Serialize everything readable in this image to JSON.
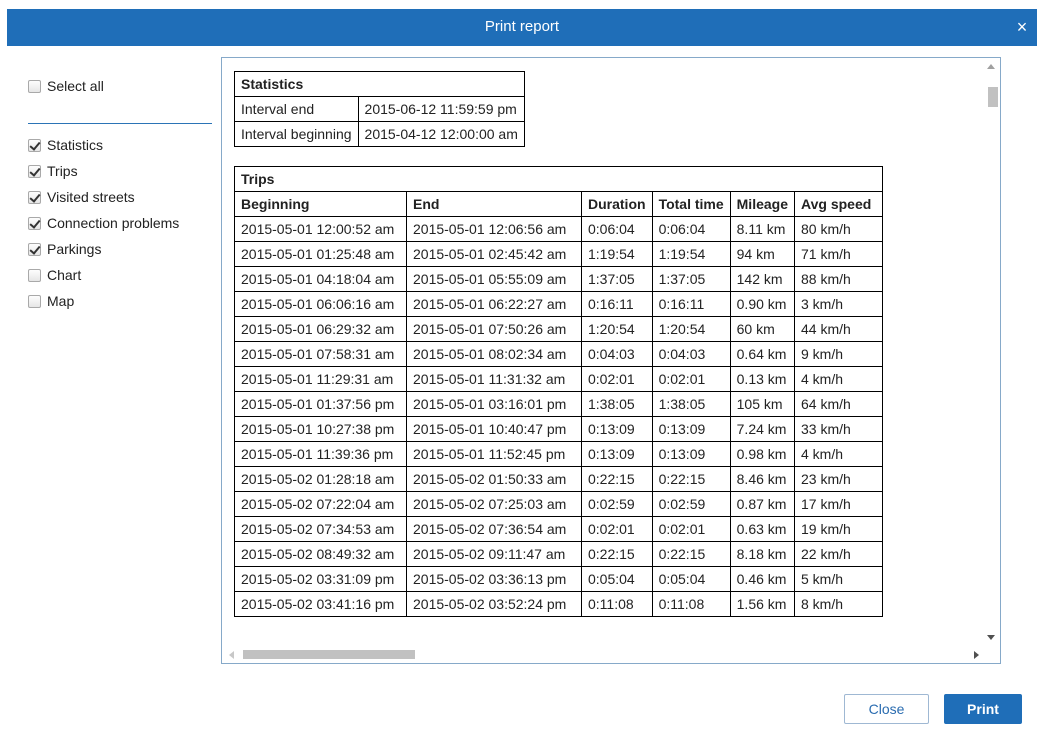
{
  "dialog": {
    "title": "Print report",
    "close_glyph": "×"
  },
  "sidebar": {
    "select_all": {
      "label": "Select all",
      "checked": false
    },
    "items": [
      {
        "label": "Statistics",
        "checked": true
      },
      {
        "label": "Trips",
        "checked": true
      },
      {
        "label": "Visited streets",
        "checked": true
      },
      {
        "label": "Connection problems",
        "checked": true
      },
      {
        "label": "Parkings",
        "checked": true
      },
      {
        "label": "Chart",
        "checked": false
      },
      {
        "label": "Map",
        "checked": false
      }
    ]
  },
  "statistics": {
    "title": "Statistics",
    "rows": [
      [
        "Interval end",
        "2015-06-12 11:59:59 pm"
      ],
      [
        "Interval beginning",
        "2015-04-12 12:00:00 am"
      ]
    ]
  },
  "trips": {
    "title": "Trips",
    "headers": [
      "Beginning",
      "End",
      "Duration",
      "Total time",
      "Mileage",
      "Avg speed"
    ],
    "rows": [
      [
        "2015-05-01 12:00:52 am",
        "2015-05-01 12:06:56 am",
        "0:06:04",
        "0:06:04",
        "8.11 km",
        "80 km/h"
      ],
      [
        "2015-05-01 01:25:48 am",
        "2015-05-01 02:45:42 am",
        "1:19:54",
        "1:19:54",
        "94 km",
        "71 km/h"
      ],
      [
        "2015-05-01 04:18:04 am",
        "2015-05-01 05:55:09 am",
        "1:37:05",
        "1:37:05",
        "142 km",
        "88 km/h"
      ],
      [
        "2015-05-01 06:06:16 am",
        "2015-05-01 06:22:27 am",
        "0:16:11",
        "0:16:11",
        "0.90 km",
        "3 km/h"
      ],
      [
        "2015-05-01 06:29:32 am",
        "2015-05-01 07:50:26 am",
        "1:20:54",
        "1:20:54",
        "60 km",
        "44 km/h"
      ],
      [
        "2015-05-01 07:58:31 am",
        "2015-05-01 08:02:34 am",
        "0:04:03",
        "0:04:03",
        "0.64 km",
        "9 km/h"
      ],
      [
        "2015-05-01 11:29:31 am",
        "2015-05-01 11:31:32 am",
        "0:02:01",
        "0:02:01",
        "0.13 km",
        "4 km/h"
      ],
      [
        "2015-05-01 01:37:56 pm",
        "2015-05-01 03:16:01 pm",
        "1:38:05",
        "1:38:05",
        "105 km",
        "64 km/h"
      ],
      [
        "2015-05-01 10:27:38 pm",
        "2015-05-01 10:40:47 pm",
        "0:13:09",
        "0:13:09",
        "7.24 km",
        "33 km/h"
      ],
      [
        "2015-05-01 11:39:36 pm",
        "2015-05-01 11:52:45 pm",
        "0:13:09",
        "0:13:09",
        "0.98 km",
        "4 km/h"
      ],
      [
        "2015-05-02 01:28:18 am",
        "2015-05-02 01:50:33 am",
        "0:22:15",
        "0:22:15",
        "8.46 km",
        "23 km/h"
      ],
      [
        "2015-05-02 07:22:04 am",
        "2015-05-02 07:25:03 am",
        "0:02:59",
        "0:02:59",
        "0.87 km",
        "17 km/h"
      ],
      [
        "2015-05-02 07:34:53 am",
        "2015-05-02 07:36:54 am",
        "0:02:01",
        "0:02:01",
        "0.63 km",
        "19 km/h"
      ],
      [
        "2015-05-02 08:49:32 am",
        "2015-05-02 09:11:47 am",
        "0:22:15",
        "0:22:15",
        "8.18 km",
        "22 km/h"
      ],
      [
        "2015-05-02 03:31:09 pm",
        "2015-05-02 03:36:13 pm",
        "0:05:04",
        "0:05:04",
        "0.46 km",
        "5 km/h"
      ],
      [
        "2015-05-02 03:41:16 pm",
        "2015-05-02 03:52:24 pm",
        "0:11:08",
        "0:11:08",
        "1.56 km",
        "8 km/h"
      ]
    ]
  },
  "buttons": {
    "close": "Close",
    "print": "Print"
  },
  "colors": {
    "accent": "#1f6eb8",
    "divider": "#2b74b6"
  },
  "icons": {
    "close": "close-icon",
    "checkbox": "checkbox-icon"
  }
}
